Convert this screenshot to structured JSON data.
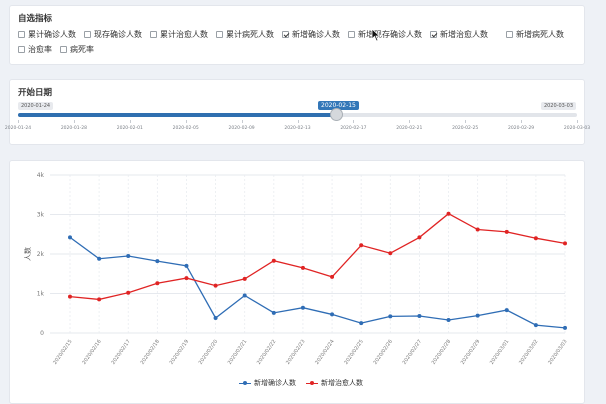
{
  "indicators": {
    "title": "自选指标",
    "items": [
      {
        "label": "累计确诊人数",
        "checked": false
      },
      {
        "label": "现存确诊人数",
        "checked": false
      },
      {
        "label": "累计治愈人数",
        "checked": false
      },
      {
        "label": "累计病死人数",
        "checked": false
      },
      {
        "label": "新增确诊人数",
        "checked": true
      },
      {
        "label": "新增现存确诊人数",
        "checked": false
      },
      {
        "label": "新增治愈人数",
        "checked": true
      },
      {
        "label": "新增病死人数",
        "checked": false
      },
      {
        "label": "治愈率",
        "checked": false
      },
      {
        "label": "病死率",
        "checked": false
      }
    ]
  },
  "slider": {
    "title": "开始日期",
    "min_label": "2020-01-24",
    "max_label": "2020-03-03",
    "current_label": "2020-02-15",
    "position_fraction": 0.565,
    "ticks": [
      "2020-01-24",
      "2020-01-28",
      "2020-02-01",
      "2020-02-05",
      "2020-02-09",
      "2020-02-13",
      "2020-02-17",
      "2020-02-21",
      "2020-02-25",
      "2020-02-29",
      "2020-03-03"
    ]
  },
  "chart_data": {
    "type": "line",
    "ylabel": "人数",
    "ylim": [
      0,
      4000
    ],
    "yticks": [
      "0",
      "1k",
      "2k",
      "3k",
      "4k"
    ],
    "categories": [
      "2020/02/15",
      "2020/02/16",
      "2020/02/17",
      "2020/02/18",
      "2020/02/19",
      "2020/02/20",
      "2020/02/21",
      "2020/02/22",
      "2020/02/23",
      "2020/02/24",
      "2020/02/25",
      "2020/02/26",
      "2020/02/27",
      "2020/02/28",
      "2020/02/29",
      "2020/03/01",
      "2020/03/02",
      "2020/03/03"
    ],
    "series": [
      {
        "name": "新增确诊人数",
        "color": "#2f6db5",
        "values": [
          2420,
          1880,
          1950,
          1820,
          1700,
          380,
          950,
          510,
          640,
          470,
          250,
          420,
          430,
          330,
          440,
          580,
          200,
          130
        ]
      },
      {
        "name": "新增治愈人数",
        "color": "#e02424",
        "values": [
          920,
          850,
          1020,
          1260,
          1390,
          1200,
          1370,
          1830,
          1650,
          1420,
          2220,
          2020,
          2420,
          3020,
          2620,
          2560,
          2400,
          2270
        ]
      }
    ],
    "grid": true,
    "legend": "bottom-center"
  }
}
